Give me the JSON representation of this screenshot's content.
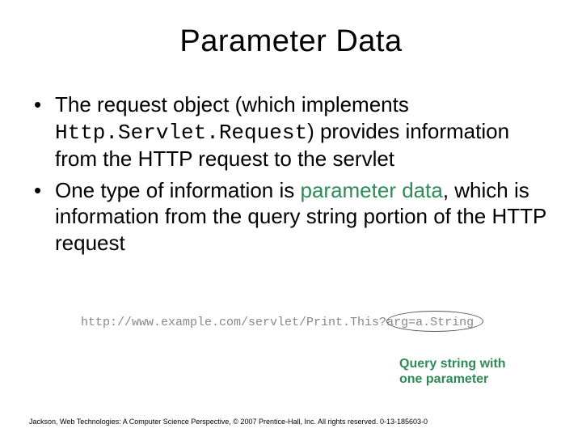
{
  "title": "Parameter Data",
  "bullets": {
    "b1_pre": "The request object (which implements ",
    "b1_code": "Http.Servlet.Request",
    "b1_post": ") provides information from the HTTP request to the servlet",
    "b2_pre": "One type of information is ",
    "b2_term": "parameter data",
    "b2_post": ", which is information from the query string portion of the HTTP request"
  },
  "url": {
    "base": "http://www.example.com/servlet/Print.This?",
    "query": "arg=a.String"
  },
  "callout": {
    "line1": "Query string with",
    "line2": "one parameter"
  },
  "footer": "Jackson, Web Technologies: A Computer Science Perspective, © 2007 Prentice-Hall, Inc. All rights reserved. 0-13-185603-0"
}
